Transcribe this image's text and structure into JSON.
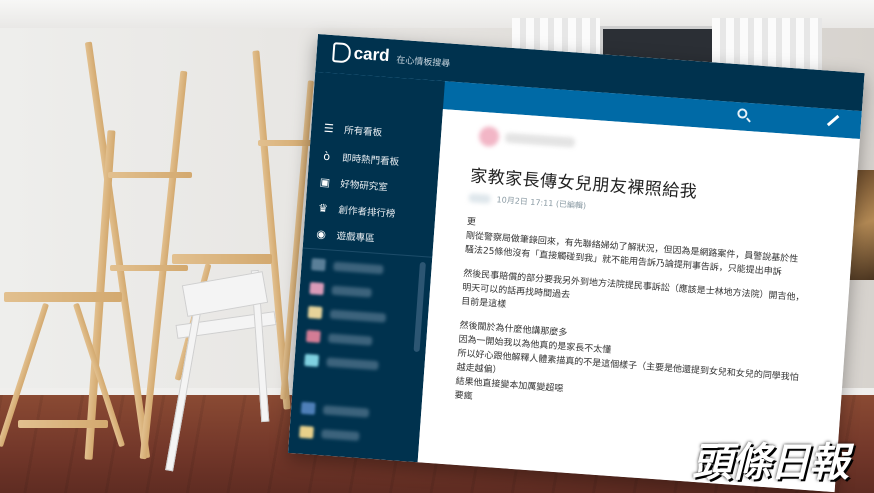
{
  "app": {
    "logo_text": "card",
    "search_placeholder": "在心情板搜尋"
  },
  "sidebar": {
    "items": [
      {
        "label": "所有看板",
        "icon": "board-list-icon"
      },
      {
        "label": "即時熱門看板",
        "icon": "hot-icon"
      },
      {
        "label": "好物研究室",
        "icon": "shop-icon"
      },
      {
        "label": "創作者排行榜",
        "icon": "trophy-icon"
      },
      {
        "label": "遊戲專區",
        "icon": "game-controller-icon"
      }
    ]
  },
  "post": {
    "title": "家教家長傳女兒朋友裸照給我",
    "meta": "10月2日 17:11 (已編輯)",
    "lines": [
      "更",
      "剛從警察局做筆錄回來，有先聯絡婦幼了解狀況，但因為是網路案件，員警說基於性",
      "騷法25條他沒有「直接觸碰到我」就不能用告訴乃論提刑事告訴，只能提出申訴",
      "",
      "然後民事賠償的部分要我另外到地方法院提民事訴訟（應該是士林地方法院）開吉他，",
      "明天可以的話再找時間過去",
      "目前是這樣",
      "",
      "然後關於為什麼他講那麼多",
      "因為一開始我以為他真的是家長不太懂",
      "所以好心跟他解釋人體素描真的不是這個樣子（主要是他還提到女兒和女兒的同學我怕",
      "越走越偏）",
      "結果他直接變本加厲變超噁",
      "要瘋"
    ]
  },
  "watermark": "頭條日報"
}
